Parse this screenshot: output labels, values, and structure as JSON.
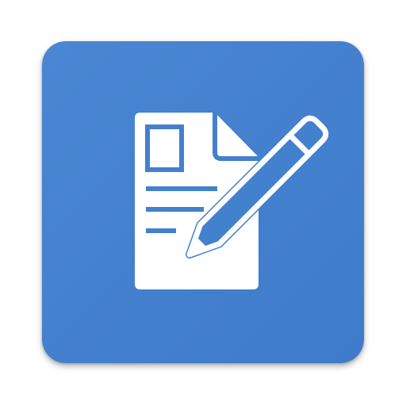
{
  "app_icon": {
    "icon": "document-edit-icon",
    "background_color": "#4380CE",
    "foreground_color": "#FFFFFF"
  }
}
